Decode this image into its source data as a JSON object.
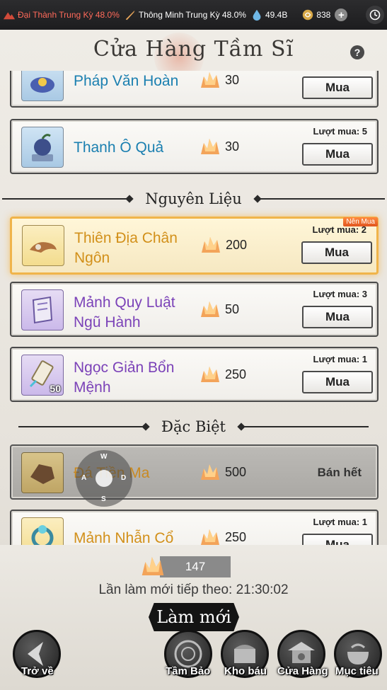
{
  "topbar": {
    "stat1": "Đại Thành Trung Kỳ 48.0%",
    "stat2": "Thông Minh Trung Kỳ 48.0%",
    "stat3": "49.4B",
    "stat4": "838",
    "plus": "+"
  },
  "header": {
    "title": "Cửa Hàng Tầm Sĩ",
    "help": "?"
  },
  "items": [
    {
      "name": "Pháp Văn Hoàn",
      "price": "30",
      "limit": "",
      "buy": "Mua"
    },
    {
      "name": "Thanh Ô Quả",
      "price": "30",
      "limit": "Lượt mua: 5",
      "buy": "Mua"
    },
    {
      "name": "Thiên Địa Chân Ngôn",
      "price": "200",
      "limit": "Lượt mua: 2",
      "buy": "Mua",
      "badge": "Nên Mua"
    },
    {
      "name": "Mảnh Quy Luật Ngũ Hành",
      "price": "50",
      "limit": "Lượt mua: 3",
      "buy": "Mua"
    },
    {
      "name": "Ngọc Giản Bổn Mệnh",
      "price": "250",
      "limit": "Lượt mua: 1",
      "buy": "Mua",
      "qty": "50"
    },
    {
      "name": "Đá Tiền Ma",
      "price": "500",
      "status": "Bán hết"
    },
    {
      "name": "Mảnh Nhẫn Cổ",
      "price": "250",
      "limit": "Lượt mua: 1",
      "buy": "Mua"
    }
  ],
  "sections": {
    "materials": "Nguyên Liệu",
    "special": "Đặc Biệt"
  },
  "joystick": {
    "up": "W",
    "left": "A",
    "right": "D",
    "down": "S"
  },
  "footer": {
    "currency": "147",
    "next_refresh": "Lần làm mới tiếp theo: 21:30:02",
    "refresh_button": "Làm mới"
  },
  "nav": {
    "back": "Trở về",
    "tam_bao": "Tầm Bảo",
    "kho_bau": "Kho báu",
    "cua_hang": "Cửa Hàng",
    "muc_tieu": "Mục tiêu"
  },
  "colors": {
    "highlight_border": "#f0b44a",
    "blue_name": "#1a7fb0",
    "gold_name": "#d2901a",
    "purple_name": "#7b42b8"
  }
}
